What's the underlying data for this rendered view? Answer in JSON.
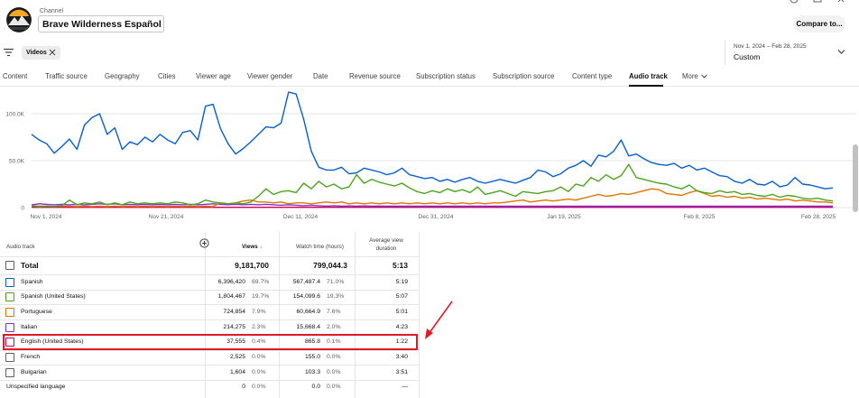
{
  "header": {
    "channel_label": "Channel",
    "channel_name": "Brave Wilderness Español",
    "compare_label": "Compare to..."
  },
  "filters": {
    "chip_label": "Videos",
    "date_range": "Nov 1, 2024 – Feb 28, 2025",
    "date_preset": "Custom"
  },
  "tabs": [
    {
      "label": "Content"
    },
    {
      "label": "Traffic source"
    },
    {
      "label": "Geography"
    },
    {
      "label": "Cities"
    },
    {
      "label": "Viewer age"
    },
    {
      "label": "Viewer gender"
    },
    {
      "label": "Date"
    },
    {
      "label": "Revenue source"
    },
    {
      "label": "Subscription status"
    },
    {
      "label": "Subscription source"
    },
    {
      "label": "Content type"
    },
    {
      "label": "Audio track",
      "active": true
    },
    {
      "label": "More"
    }
  ],
  "chart_data": {
    "type": "line",
    "y_ticks": [
      "100.0K",
      "50.0K",
      "0"
    ],
    "ylim": [
      0,
      125000
    ],
    "x_ticks": [
      "Nov 1, 2024",
      "Nov 21, 2024",
      "Dec 11, 2024",
      "Dec 31, 2024",
      "Jan 19, 2025",
      "Feb 8, 2025",
      "Feb 28, 2025"
    ],
    "series": [
      {
        "color": "#065fd4",
        "values": [
          78000,
          72000,
          68000,
          58000,
          65000,
          73000,
          62000,
          88000,
          96000,
          100000,
          78000,
          85000,
          62000,
          70000,
          67000,
          75000,
          70000,
          78000,
          72000,
          68000,
          80000,
          82000,
          72000,
          108000,
          110000,
          84000,
          68000,
          57000,
          63000,
          70000,
          78000,
          86000,
          85000,
          90000,
          123000,
          121000,
          94000,
          60000,
          43000,
          40000,
          40000,
          43000,
          36000,
          37000,
          42000,
          40000,
          38000,
          35000,
          37000,
          42000,
          35000,
          33000,
          31000,
          32000,
          28000,
          30000,
          27000,
          30000,
          32000,
          28000,
          26000,
          28000,
          30000,
          28000,
          26000,
          29000,
          32000,
          40000,
          38000,
          33000,
          36000,
          42000,
          45000,
          50000,
          44000,
          56000,
          54000,
          60000,
          72000,
          55000,
          57000,
          52000,
          48000,
          46000,
          45000,
          47000,
          42000,
          45000,
          40000,
          42000,
          38000,
          34000,
          33000,
          28000,
          26000,
          30000,
          25000,
          24000,
          28000,
          22000,
          24000,
          32000,
          25000,
          24000,
          22000,
          20000,
          21000
        ]
      },
      {
        "color": "#4aa51c",
        "values": [
          2000,
          1000,
          1500,
          1200,
          2000,
          8000,
          3000,
          5000,
          4000,
          6000,
          3000,
          5000,
          3000,
          6000,
          4000,
          5000,
          4000,
          5000,
          4000,
          6000,
          5000,
          3000,
          4000,
          8000,
          6000,
          5000,
          4000,
          5000,
          4000,
          6000,
          12000,
          20000,
          14000,
          17000,
          18000,
          16000,
          26000,
          20000,
          28000,
          22000,
          25000,
          20000,
          22000,
          35000,
          26000,
          30000,
          27000,
          25000,
          23000,
          26000,
          21000,
          17000,
          15000,
          18000,
          16000,
          20000,
          17000,
          19000,
          16000,
          22000,
          14000,
          16000,
          18000,
          15000,
          12000,
          17000,
          16000,
          15000,
          17000,
          18000,
          22000,
          17000,
          25000,
          23000,
          32000,
          28000,
          35000,
          30000,
          34000,
          46000,
          32000,
          30000,
          28000,
          26000,
          25000,
          22000,
          20000,
          24000,
          18000,
          16000,
          15000,
          18000,
          16000,
          17000,
          14000,
          15000,
          13000,
          12000,
          14000,
          11000,
          13000,
          12000,
          10000,
          9000,
          10000,
          8000,
          7000
        ]
      },
      {
        "color": "#e37400",
        "values": [
          2000,
          1500,
          1500,
          1200,
          1500,
          1500,
          1200,
          1500,
          1200,
          1500,
          1200,
          1500,
          1200,
          1500,
          1200,
          1500,
          1200,
          1500,
          1200,
          1500,
          1200,
          1500,
          1200,
          1500,
          1200,
          5000,
          4000,
          5000,
          7000,
          8000,
          6000,
          6000,
          5000,
          6000,
          4000,
          5000,
          5000,
          4000,
          5000,
          6000,
          5000,
          6000,
          4000,
          5000,
          4000,
          5000,
          4000,
          5000,
          4000,
          5000,
          4000,
          5000,
          4000,
          5000,
          4000,
          5000,
          4000,
          5000,
          4000,
          5000,
          4000,
          5000,
          5000,
          6000,
          7000,
          8000,
          6000,
          7000,
          8000,
          7000,
          8000,
          9000,
          8000,
          10000,
          12000,
          14000,
          12000,
          13000,
          15000,
          14000,
          16000,
          18000,
          20000,
          19000,
          15000,
          14000,
          13000,
          16000,
          18000,
          15000,
          12000,
          13000,
          11000,
          12000,
          10000,
          11000,
          9000,
          10000,
          9000,
          8000,
          9000,
          7000,
          8000,
          7000,
          6000,
          6000,
          5000
        ]
      },
      {
        "color": "#8430ce",
        "values": [
          3000,
          4000,
          3500,
          3000,
          3500,
          3000,
          3500,
          3000,
          3500,
          4000,
          3500,
          4000,
          3000,
          3500,
          3000,
          3500,
          3000,
          3500,
          3000,
          3500,
          3000,
          3500,
          3000,
          3500,
          4000,
          3500,
          3000,
          3500,
          3000,
          3500,
          3000,
          3500,
          3000,
          2500,
          3000,
          2500,
          2000,
          2500,
          2000,
          1500,
          2000,
          1500,
          1800,
          1500,
          1800,
          1500,
          1600,
          1500,
          1500,
          1400,
          1500,
          1400,
          1500,
          1400,
          1500,
          1400,
          1500,
          1400,
          1500,
          1400,
          1500,
          1400,
          1500,
          1400,
          1500,
          1400,
          1500,
          1400,
          1500,
          1400,
          1500,
          1400,
          1500,
          1400,
          1500,
          1400,
          1500,
          1400,
          1500,
          1400,
          1500,
          1400,
          1500,
          1400,
          1500,
          1400,
          1500,
          1400,
          1500,
          1400,
          1500,
          1400,
          1500,
          1400,
          1500,
          1400,
          1500,
          1400,
          1500,
          1400,
          1500,
          1400,
          1500,
          1400,
          1500,
          1400,
          1500
        ]
      },
      {
        "color": "#cc0052",
        "values": [
          300,
          300,
          300,
          300,
          300,
          300,
          300,
          300,
          300,
          300,
          300,
          300,
          300,
          300,
          300,
          300,
          300,
          300,
          300,
          300,
          300,
          300,
          300,
          300,
          300,
          300,
          300,
          300,
          300,
          300,
          300,
          300,
          300,
          300,
          300,
          300,
          300,
          300,
          300,
          300,
          300,
          300,
          300,
          300,
          300,
          300,
          300,
          300,
          300,
          300,
          300,
          300,
          300,
          300,
          300,
          300,
          300,
          300,
          300,
          300,
          300,
          300,
          300,
          300,
          300,
          300,
          300,
          300,
          300,
          300,
          300,
          300,
          300,
          300,
          300,
          300,
          300,
          300,
          300,
          300,
          300,
          300,
          300,
          300,
          300,
          300,
          300,
          300,
          300,
          300,
          300,
          300,
          300,
          300,
          300,
          300,
          300,
          300,
          300,
          300,
          300,
          300,
          300,
          300,
          300,
          300,
          300
        ]
      }
    ]
  },
  "table": {
    "headers": {
      "audio_track": "Audio track",
      "views": "Views",
      "watch_time": "Watch time (hours)",
      "avg_duration": "Average view duration"
    },
    "total": {
      "label": "Total",
      "views": "9,181,700",
      "watch": "799,044.3",
      "avg": "5:13"
    },
    "rows": [
      {
        "label": "Spanish",
        "color": "#065fd4",
        "views": "6,396,420",
        "views_pct": "69.7%",
        "watch": "567,487.4",
        "watch_pct": "71.0%",
        "avg": "5:19"
      },
      {
        "label": "Spanish (United States)",
        "color": "#4aa51c",
        "views": "1,804,467",
        "views_pct": "19.7%",
        "watch": "154,099.6",
        "watch_pct": "19.3%",
        "avg": "5:07"
      },
      {
        "label": "Portuguese",
        "color": "#e37400",
        "views": "724,854",
        "views_pct": "7.9%",
        "watch": "60,664.9",
        "watch_pct": "7.6%",
        "avg": "5:01"
      },
      {
        "label": "Italian",
        "color": "#8430ce",
        "views": "214,275",
        "views_pct": "2.3%",
        "watch": "15,668.4",
        "watch_pct": "2.0%",
        "avg": "4:23"
      },
      {
        "label": "English (United States)",
        "color": "#cc0052",
        "views": "37,555",
        "views_pct": "0.4%",
        "watch": "865.8",
        "watch_pct": "0.1%",
        "avg": "1:22"
      },
      {
        "label": "French",
        "color": "#606060",
        "views": "2,525",
        "views_pct": "0.0%",
        "watch": "155.0",
        "watch_pct": "0.0%",
        "avg": "3:40"
      },
      {
        "label": "Bulgarian",
        "color": "#606060",
        "views": "1,604",
        "views_pct": "0.0%",
        "watch": "103.3",
        "watch_pct": "0.0%",
        "avg": "3:51"
      },
      {
        "label": "Unspecified language",
        "color": "",
        "views": "0",
        "views_pct": "0.0%",
        "watch": "0.0",
        "watch_pct": "0.0%",
        "avg": "—"
      }
    ]
  },
  "colors": {
    "highlight": "#e01b24",
    "accent": "#065fd4"
  }
}
